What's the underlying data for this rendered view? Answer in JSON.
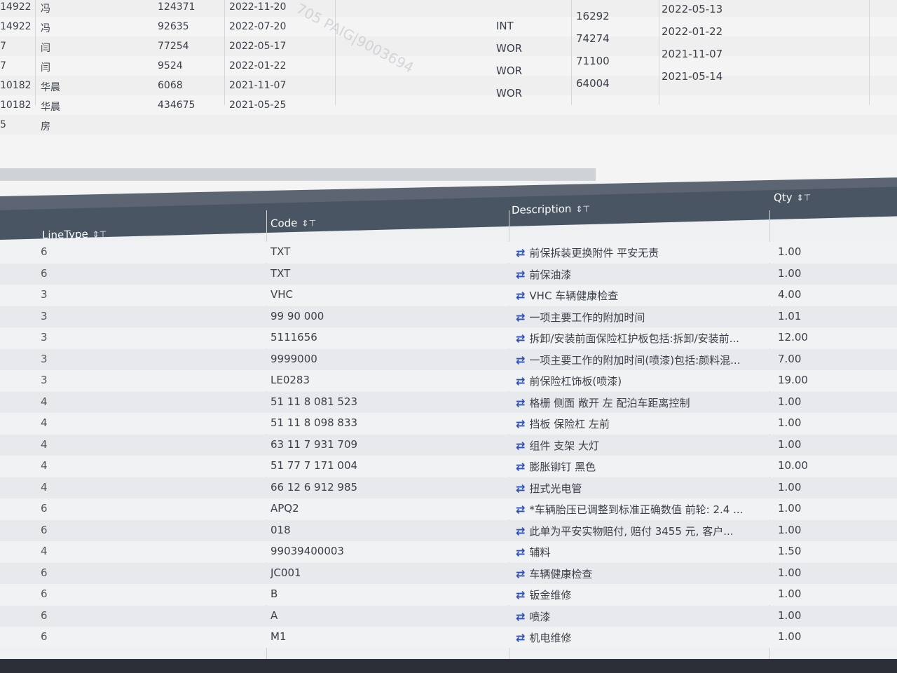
{
  "top_table": {
    "rows": [
      {
        "id": "14922",
        "name": "冯",
        "value": "124371",
        "date": "2022-11-20"
      },
      {
        "id": "14922",
        "name": "冯",
        "value": "92635",
        "date": "2022-07-20"
      },
      {
        "id": "7",
        "name": "闫",
        "value": "77254",
        "date": "2022-05-17"
      },
      {
        "id": "7",
        "name": "闫",
        "value": "9524",
        "date": "2022-01-22"
      },
      {
        "id": "10182",
        "name": "华晨",
        "value": "6068",
        "date": "2021-11-07"
      },
      {
        "id": "10182",
        "name": "华晨",
        "value": "434675",
        "date": "2021-05-25"
      },
      {
        "id": "5",
        "name": "房",
        "value": "",
        "date": ""
      }
    ],
    "right_rows": [
      {
        "type": "INT",
        "amount": "16292",
        "date": "2022-05-13"
      },
      {
        "type": "WOR",
        "amount": "74274",
        "date": "2022-01-22"
      },
      {
        "type": "WOR",
        "amount": "71100",
        "date": "2021-11-07"
      },
      {
        "type": "WOR",
        "amount": "64004",
        "date": "2021-05-14"
      }
    ]
  },
  "watermark": "705 PAIG|9003694",
  "grid": {
    "columns": {
      "line_type": "LineType",
      "code": "Code",
      "description": "Description",
      "qty": "Qty"
    },
    "sort_icon": "⇕",
    "filter_icon": "⊤",
    "rows": [
      {
        "type": "6",
        "code": "TXT",
        "desc": "前保拆装更换附件 平安无责",
        "qty": "1.00"
      },
      {
        "type": "6",
        "code": "TXT",
        "desc": "前保油漆",
        "qty": "1.00"
      },
      {
        "type": "3",
        "code": "VHC",
        "desc": "VHC 车辆健康检查",
        "qty": "4.00"
      },
      {
        "type": "3",
        "code": "99 90 000",
        "desc": "一项主要工作的附加时间",
        "qty": "1.01"
      },
      {
        "type": "3",
        "code": "5111656",
        "desc": "拆卸/安装前面保险杠护板包括:拆卸/安装前...",
        "qty": "12.00"
      },
      {
        "type": "3",
        "code": "9999000",
        "desc": "一项主要工作的附加时间(喷漆)包括:颜料混...",
        "qty": "7.00"
      },
      {
        "type": "3",
        "code": "LE0283",
        "desc": "前保险杠饰板(喷漆)",
        "qty": "19.00"
      },
      {
        "type": "4",
        "code": "51 11 8 081 523",
        "desc": "格栅 侧面 敞开 左 配泊车距离控制",
        "qty": "1.00"
      },
      {
        "type": "4",
        "code": "51 11 8 098 833",
        "desc": "挡板 保险杠 左前",
        "qty": "1.00"
      },
      {
        "type": "4",
        "code": "63 11 7 931 709",
        "desc": "组件 支架 大灯",
        "qty": "1.00"
      },
      {
        "type": "4",
        "code": "51 77 7 171 004",
        "desc": "膨胀铆钉 黑色",
        "qty": "10.00"
      },
      {
        "type": "4",
        "code": "66 12 6 912 985",
        "desc": "扭式光电管",
        "qty": "1.00"
      },
      {
        "type": "6",
        "code": "APQ2",
        "desc": "*车辆胎压已调整到标准正确数值 前轮: 2.4 ...",
        "qty": "1.00"
      },
      {
        "type": "6",
        "code": "018",
        "desc": "此单为平安实物赔付, 赔付 3455 元, 客户...",
        "qty": "1.00"
      },
      {
        "type": "4",
        "code": "99039400003",
        "desc": "辅料",
        "qty": "1.50"
      },
      {
        "type": "6",
        "code": "JC001",
        "desc": "车辆健康检查",
        "qty": "1.00"
      },
      {
        "type": "6",
        "code": "B",
        "desc": "钣金维修",
        "qty": "1.00"
      },
      {
        "type": "6",
        "code": "A",
        "desc": "喷漆",
        "qty": "1.00"
      },
      {
        "type": "6",
        "code": "M1",
        "desc": "机电维修",
        "qty": "1.00"
      }
    ]
  },
  "icons": {
    "swap": "swap-arrows-icon"
  }
}
